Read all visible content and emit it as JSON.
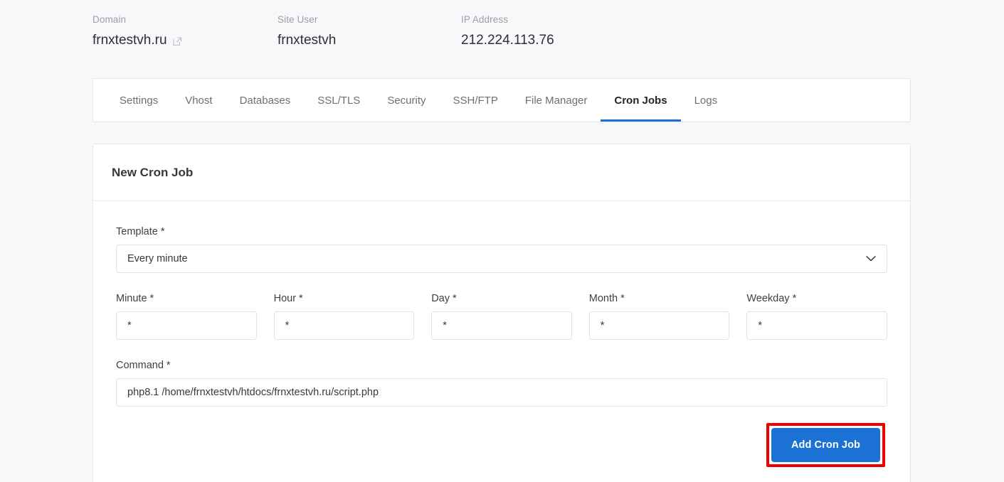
{
  "header": {
    "domain_label": "Domain",
    "domain_value": "frnxtestvh.ru",
    "site_user_label": "Site User",
    "site_user_value": "frnxtestvh",
    "ip_label": "IP Address",
    "ip_value": "212.224.113.76",
    "external_link_icon": "external-link-icon"
  },
  "tabs": [
    {
      "label": "Settings",
      "active": false
    },
    {
      "label": "Vhost",
      "active": false
    },
    {
      "label": "Databases",
      "active": false
    },
    {
      "label": "SSL/TLS",
      "active": false
    },
    {
      "label": "Security",
      "active": false
    },
    {
      "label": "SSH/FTP",
      "active": false
    },
    {
      "label": "File Manager",
      "active": false
    },
    {
      "label": "Cron Jobs",
      "active": true
    },
    {
      "label": "Logs",
      "active": false
    }
  ],
  "card": {
    "title": "New Cron Job",
    "template": {
      "label": "Template *",
      "value": "Every minute",
      "chevron_icon": "chevron-down-icon"
    },
    "schedule": [
      {
        "label": "Minute *",
        "value": "*",
        "name": "minute"
      },
      {
        "label": "Hour *",
        "value": "*",
        "name": "hour"
      },
      {
        "label": "Day *",
        "value": "*",
        "name": "day"
      },
      {
        "label": "Month *",
        "value": "*",
        "name": "month"
      },
      {
        "label": "Weekday *",
        "value": "*",
        "name": "weekday"
      }
    ],
    "command": {
      "label": "Command *",
      "value": "php8.1 /home/frnxtestvh/htdocs/frnxtestvh.ru/script.php"
    },
    "submit_label": "Add Cron Job"
  },
  "colors": {
    "accent_blue": "#1b72d4",
    "annotation_red": "#ee0000",
    "page_background": "#f7f8fa",
    "card_background": "#ffffff",
    "border": "#e4e6e9",
    "label_gray": "#9b9ea3",
    "text_dark": "#343a40"
  }
}
